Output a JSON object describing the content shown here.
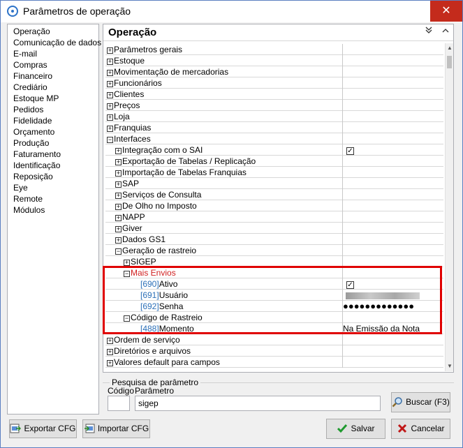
{
  "window": {
    "title": "Parâmetros de operação",
    "close_glyph": "✕"
  },
  "sidebar": {
    "items": [
      "Operação",
      "Comunicação de dados",
      "E-mail",
      "Compras",
      "Financeiro",
      "Crediário",
      "Estoque MP",
      "Pedidos",
      "Fidelidade",
      "Orçamento",
      "Produção",
      "Faturamento",
      "Identificação",
      "Reposição",
      "Eye",
      "Remote",
      "Módulos"
    ]
  },
  "panel": {
    "title": "Operação",
    "collapse_all_icon": "chevron-double-down-icon",
    "expand_all_icon": "chevron-up-icon"
  },
  "tree": [
    {
      "label": "Parâmetros gerais",
      "expander": "+",
      "value": ""
    },
    {
      "label": "Estoque",
      "expander": "+",
      "value": ""
    },
    {
      "label": "Movimentação de mercadorias",
      "expander": "+",
      "value": ""
    },
    {
      "label": "Funcionários",
      "expander": "+",
      "value": ""
    },
    {
      "label": "Clientes",
      "expander": "+",
      "value": ""
    },
    {
      "label": "Preços",
      "expander": "+",
      "value": ""
    },
    {
      "label": "Loja",
      "expander": "+",
      "value": ""
    },
    {
      "label": "Franquias",
      "expander": "+",
      "value": ""
    },
    {
      "label": "Interfaces",
      "expander": "−",
      "value": ""
    },
    {
      "label": "Integração com o SAI",
      "expander": "+",
      "value": "✓"
    },
    {
      "label": "Exportação de Tabelas / Replicação",
      "expander": "+",
      "value": ""
    },
    {
      "label": "Importação de Tabelas Franquias",
      "expander": "+",
      "value": ""
    },
    {
      "label": "SAP",
      "expander": "+",
      "value": ""
    },
    {
      "label": "Serviços de Consulta",
      "expander": "+",
      "value": ""
    },
    {
      "label": "De Olho no Imposto",
      "expander": "+",
      "value": ""
    },
    {
      "label": "NAPP",
      "expander": "+",
      "value": ""
    },
    {
      "label": "Giver",
      "expander": "+",
      "value": ""
    },
    {
      "label": "Dados GS1",
      "expander": "+",
      "value": ""
    },
    {
      "label": "Geração de rastreio",
      "expander": "−",
      "value": ""
    },
    {
      "label": "SIGEP",
      "expander": "+",
      "value": ""
    },
    {
      "label": "Mais Envios",
      "expander": "−",
      "value": ""
    },
    {
      "code": "[690]",
      "label": "Ativo",
      "value": "✓"
    },
    {
      "code": "[691]",
      "label": "Usuário",
      "value": ""
    },
    {
      "code": "[692]",
      "label": "Senha",
      "value": "●●●●●●●●●●●●●"
    },
    {
      "label": "Código de Rastreio",
      "expander": "−",
      "value": ""
    },
    {
      "code": "[488]",
      "label": "Momento",
      "value": "Na Emissão da Nota"
    },
    {
      "label": "Ordem de serviço",
      "expander": "+",
      "value": ""
    },
    {
      "label": "Diretórios e arquivos",
      "expander": "+",
      "value": ""
    },
    {
      "label": "Valores default para campos",
      "expander": "+",
      "value": ""
    }
  ],
  "search": {
    "legend": "Pesquisa de parâmetro",
    "code_label": "Código",
    "param_label": "Parâmetro",
    "param_value": "sigep",
    "search_button": "Buscar (F3)"
  },
  "footer": {
    "export_button": "Exportar CFG",
    "import_button": "Importar CFG",
    "save_button": "Salvar",
    "cancel_button": "Cancelar"
  },
  "colors": {
    "highlight": "#e00000",
    "code": "#2b6fb8",
    "selected_red": "#d01f1f",
    "close_bg": "#c42b1c"
  }
}
